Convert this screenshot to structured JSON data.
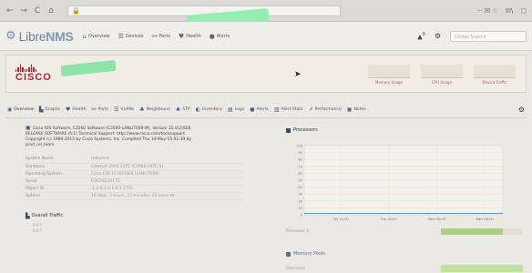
{
  "browser": {
    "back": "←",
    "forward": "→",
    "reload": "C",
    "home": "⌂",
    "right_icons": "··· ☒ ☆",
    "library": "III\\",
    "sidebar_toggle": "▢"
  },
  "app": {
    "logo_text_a": "Libre",
    "logo_text_b": "NMS",
    "menu": [
      {
        "icon": "home-icon",
        "glyph": "⌂",
        "label": "Overview"
      },
      {
        "icon": "server-icon",
        "glyph": "☰",
        "label": "Devices"
      },
      {
        "icon": "link-icon",
        "glyph": "⚯",
        "label": "Ports"
      },
      {
        "icon": "heart-icon",
        "glyph": "♥",
        "label": "Health"
      },
      {
        "icon": "alert-icon",
        "glyph": "●",
        "label": "Alerts"
      }
    ],
    "alerts_glyph": "▲",
    "alerts_count": "0",
    "settings_glyph": "⚙",
    "search_placeholder": "Global Search"
  },
  "device_header": {
    "vendor": "CISCO",
    "graphs": [
      {
        "label": "Memory Usage"
      },
      {
        "label": "CPU Usage"
      },
      {
        "label": "Device Traffic"
      }
    ]
  },
  "tabs": [
    {
      "icon": "lightbulb-icon",
      "glyph": "◉",
      "label": "Overview"
    },
    {
      "icon": "graphs-icon",
      "glyph": "▙",
      "label": "Graphs"
    },
    {
      "icon": "health-icon",
      "glyph": "♥",
      "label": "Health"
    },
    {
      "icon": "ports-icon",
      "glyph": "⚯",
      "label": "Ports"
    },
    {
      "icon": "vlans-icon",
      "glyph": "☰",
      "label": "VLANs"
    },
    {
      "icon": "neighbours-icon",
      "glyph": "♣",
      "label": "Neighbours"
    },
    {
      "icon": "stp-icon",
      "glyph": "♣",
      "label": "STP"
    },
    {
      "icon": "inventory-icon",
      "glyph": "◐",
      "label": "Inventory"
    },
    {
      "icon": "logs-icon",
      "glyph": "▤",
      "label": "Logs"
    },
    {
      "icon": "alerts-icon",
      "glyph": "●",
      "label": "Alerts"
    },
    {
      "icon": "alert-stats-icon",
      "glyph": "▥",
      "label": "Alert Stats"
    },
    {
      "icon": "performance-icon",
      "glyph": "↗",
      "label": "Performance"
    },
    {
      "icon": "notes-icon",
      "glyph": "▣",
      "label": "Notes"
    }
  ],
  "tab_settings_glyph": "⚙",
  "overview": {
    "description_lines": [
      "Cisco IOS Software, C3560 Software (C3560-LANLITEK9-M), Version 15.0(2)SE8,",
      "RELEASE SOFTWARE (fc1) Technical Support: http://www.cisco.com/techsupport",
      "Copyright (c) 1986-2015 by Cisco Systems, Inc. Compiled Thu 14-May-15 02:39 by",
      "prod_rel_team"
    ],
    "info": [
      {
        "key": "System Name",
        "value": "redacted"
      },
      {
        "key": "Hardware",
        "value": "Catalyst 2960 24TC (C2960-24TC-S)"
      },
      {
        "key": "Operating System",
        "value": "Cisco IOS 15.0(2)SE8 (LANLITEK9)"
      },
      {
        "key": "Serial",
        "value": "FOC0823X172"
      },
      {
        "key": "Object ID",
        "value": ".1.3.6.1.4.1.9.1.1753"
      },
      {
        "key": "Uptime",
        "value": "16 days, 2 hours, 15 minutes, 43 seconds"
      }
    ],
    "traffic_title": "Overall Traffic",
    "traffic_lines": [
      "0.0 ?",
      "0.0 ?"
    ]
  },
  "processors": {
    "title": "Processors",
    "memory_title": "Memory Pools",
    "util_label": "Processor 0",
    "util_fraction": 0.75,
    "mem_label": "Processor"
  },
  "chart_data": {
    "type": "line",
    "title": "",
    "x": [
      "Tue 12:00",
      "Tue 18:00",
      "Wed 00:00",
      "Wed 06:00"
    ],
    "yticks": [
      "100",
      "90",
      "80",
      "70",
      "60",
      "50",
      "40",
      "30",
      "20",
      "10",
      "0"
    ],
    "ylim": [
      0,
      100
    ],
    "series": [
      {
        "values": [
          2,
          2,
          2,
          2
        ]
      }
    ],
    "grid": true
  },
  "colors": {
    "accent": "#4b5c7a",
    "cisco_red": "#b0272d",
    "util_green": "#a9d07a"
  }
}
